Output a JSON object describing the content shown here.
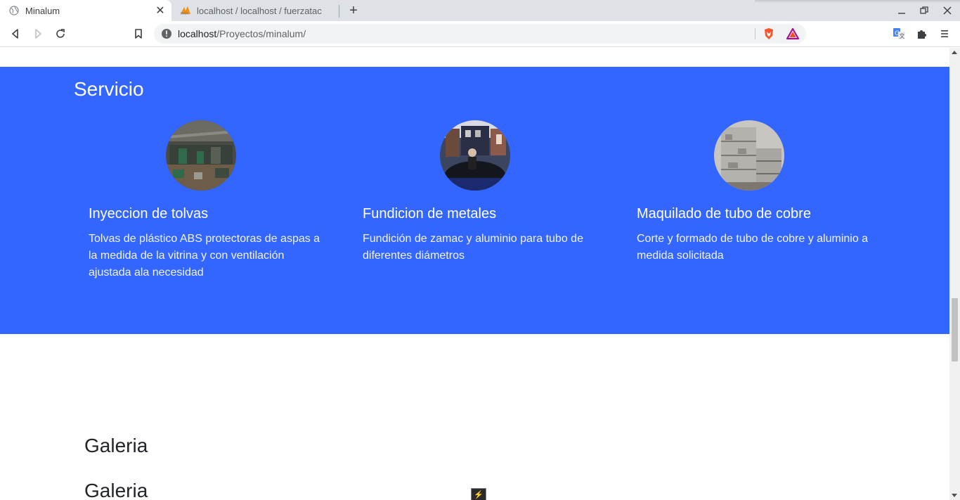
{
  "browser": {
    "tabs": [
      {
        "title": "Minalum",
        "active": true
      },
      {
        "title": "localhost / localhost / fuerzatac",
        "active": false
      }
    ],
    "url_host": "localhost",
    "url_path": "/Proyectos/minalum/"
  },
  "servicio": {
    "heading": "Servicio",
    "accent_color": "#3366ff",
    "items": [
      {
        "title": "Inyeccion de tolvas",
        "description": "Tolvas de plástico ABS protectoras de aspas a la medida de la vitrina y con ventilación ajustada ala necesidad"
      },
      {
        "title": "Fundicion de metales",
        "description": "Fundición de zamac y aluminio para tubo de diferentes diámetros"
      },
      {
        "title": "Maquilado de tubo de cobre",
        "description": "Corte y formado de tubo de cobre y aluminio a medida solicitada"
      }
    ]
  },
  "galeria": {
    "heading_1": "Galeria",
    "heading_2": "Galeria"
  }
}
